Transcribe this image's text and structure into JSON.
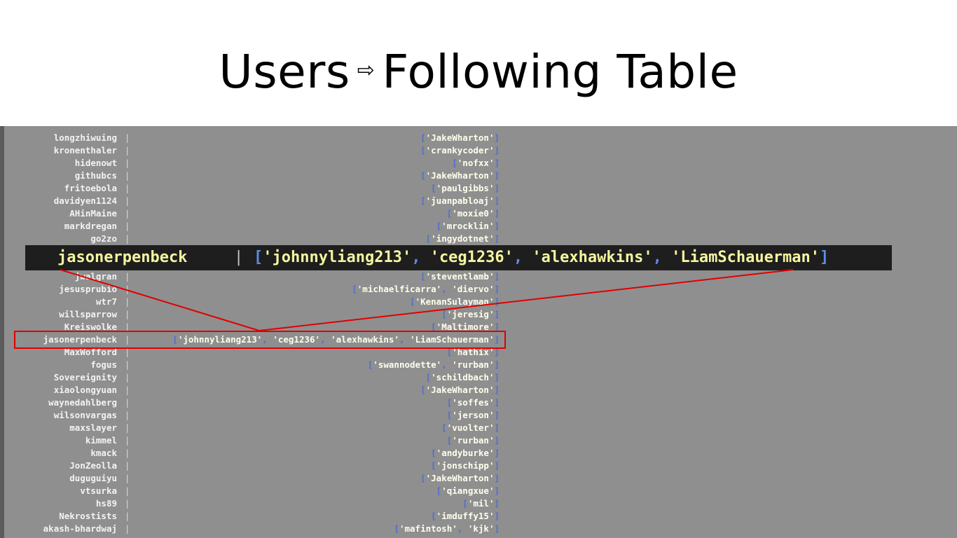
{
  "title": {
    "left": "Users",
    "arrow": "⇨",
    "right": "Following Table"
  },
  "rows": [
    {
      "user": "longzhiwuing",
      "following": [
        "JakeWharton"
      ]
    },
    {
      "user": "kronenthaler",
      "following": [
        "crankycoder"
      ]
    },
    {
      "user": "hidenowt",
      "following": [
        "nofxx"
      ]
    },
    {
      "user": "githubcs",
      "following": [
        "JakeWharton"
      ]
    },
    {
      "user": "fritoebola",
      "following": [
        "paulgibbs"
      ]
    },
    {
      "user": "davidyen1124",
      "following": [
        "juanpabloaj"
      ]
    },
    {
      "user": "AHinMaine",
      "following": [
        "moxie0"
      ]
    },
    {
      "user": "markdregan",
      "following": [
        "mrocklin"
      ]
    },
    {
      "user": "go2zo",
      "following": [
        "ingydotnet"
      ]
    },
    {
      "user": "",
      "following": []
    },
    {
      "user": "",
      "following": []
    },
    {
      "user": "jwalgran",
      "following": [
        "steventlamb"
      ]
    },
    {
      "user": "jesusprubio",
      "following": [
        "michaelficarra",
        "diervo"
      ]
    },
    {
      "user": "wtr7",
      "following": [
        "KenanSulayman"
      ]
    },
    {
      "user": "willsparrow",
      "following": [
        "jeresig"
      ]
    },
    {
      "user": "Kreiswolke",
      "following": [
        "Maltimore"
      ]
    },
    {
      "user": "jasonerpenbeck",
      "following": [
        "johnnyliang213",
        "ceg1236",
        "alexhawkins",
        "LiamSchauerman"
      ]
    },
    {
      "user": "MaxWofford",
      "following": [
        "hathix"
      ]
    },
    {
      "user": "fogus",
      "following": [
        "swannodette",
        "rurban"
      ]
    },
    {
      "user": "Sovereignity",
      "following": [
        "schildbach"
      ]
    },
    {
      "user": "xiaolongyuan",
      "following": [
        "JakeWharton"
      ]
    },
    {
      "user": "waynedahlberg",
      "following": [
        "soffes"
      ]
    },
    {
      "user": "wilsonvargas",
      "following": [
        "jerson"
      ]
    },
    {
      "user": "maxslayer",
      "following": [
        "vuolter"
      ]
    },
    {
      "user": "kimmel",
      "following": [
        "rurban"
      ]
    },
    {
      "user": "kmack",
      "following": [
        "andyburke"
      ]
    },
    {
      "user": "JonZeolla",
      "following": [
        "jonschipp"
      ]
    },
    {
      "user": "duguguiyu",
      "following": [
        "JakeWharton"
      ]
    },
    {
      "user": "vtsurka",
      "following": [
        "qiangxue"
      ]
    },
    {
      "user": "hs89",
      "following": [
        "mil"
      ]
    },
    {
      "user": "Nekrostists",
      "following": [
        "imduffy15"
      ]
    },
    {
      "user": "akash-bhardwaj",
      "following": [
        "mafintosh",
        "kjk"
      ]
    }
  ],
  "zoom": {
    "user": "jasonerpenbeck",
    "following": [
      "johnnyliang213",
      "ceg1236",
      "alexhawkins",
      "LiamSchauerman"
    ]
  },
  "colors": {
    "panel_bg": "#8f8f8f",
    "highlight": "#e00000",
    "bracket": "#4f6ed0",
    "zoom_bg": "#1e1e1e",
    "zoom_text": "#f5f5a0"
  }
}
